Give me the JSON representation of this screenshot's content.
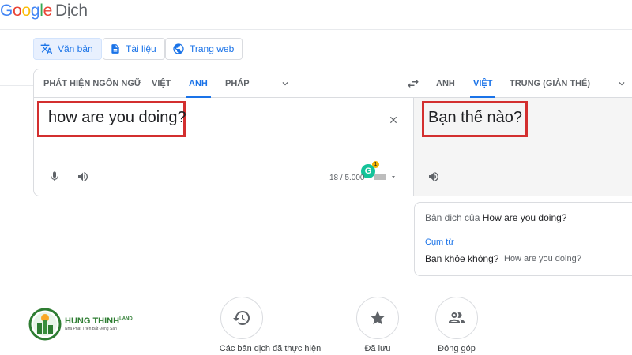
{
  "header": {
    "logo_letters": [
      "G",
      "o",
      "o",
      "g",
      "l",
      "e"
    ],
    "product": "Dịch"
  },
  "modes": [
    {
      "label": "Văn bản",
      "icon": "translate-icon",
      "active": true
    },
    {
      "label": "Tài liệu",
      "icon": "document-icon",
      "active": false
    },
    {
      "label": "Trang web",
      "icon": "globe-icon",
      "active": false
    }
  ],
  "source_languages": [
    "PHÁT HIỆN NGÔN NGỮ",
    "VIỆT",
    "ANH",
    "PHÁP"
  ],
  "source_selected": "ANH",
  "target_languages": [
    "ANH",
    "VIỆT",
    "TRUNG (GIẢN THỂ)"
  ],
  "target_selected": "VIỆT",
  "source": {
    "text": "how are you doing?",
    "char_count": "18 / 5.000",
    "grammarly_label": "G",
    "grammarly_badge": "1"
  },
  "target": {
    "text": "Bạn thế nào?"
  },
  "definitions": {
    "title_prefix": "Bản dịch của",
    "title_term": "How are you doing?",
    "section": "Cụm từ",
    "rows": [
      {
        "translation": "Bạn khỏe không?",
        "source": "How are you doing?"
      }
    ]
  },
  "actions": [
    {
      "label": "Các bản dịch đã thực hiện",
      "icon": "history-icon"
    },
    {
      "label": "Đã lưu",
      "icon": "star-icon"
    },
    {
      "label": "Đóng góp",
      "icon": "people-icon"
    }
  ],
  "watermark": {
    "name": "HUNG THINH",
    "name_suffix": "LAND",
    "slogan": "Nhà Phát Triển Bất Động Sản"
  },
  "colors": {
    "accent": "#1a73e8",
    "highlight_box": "#d32f2f",
    "target_pane_bg": "#f5f5f5"
  }
}
